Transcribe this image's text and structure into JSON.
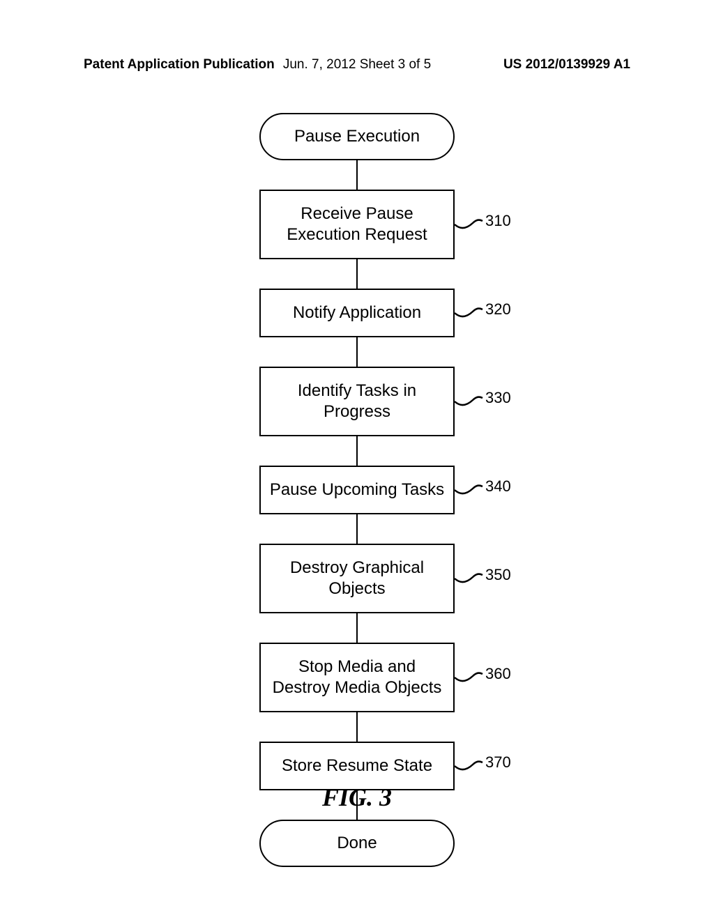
{
  "header": {
    "left": "Patent Application Publication",
    "center": "Jun. 7, 2012  Sheet 3 of 5",
    "right": "US 2012/0139929 A1"
  },
  "flowchart": {
    "start": "Pause Execution",
    "steps": [
      {
        "label": "Receive Pause Execution Request",
        "ref": "310"
      },
      {
        "label": "Notify Application",
        "ref": "320"
      },
      {
        "label": "Identify Tasks in Progress",
        "ref": "330"
      },
      {
        "label": "Pause Upcoming Tasks",
        "ref": "340"
      },
      {
        "label": "Destroy Graphical Objects",
        "ref": "350"
      },
      {
        "label": "Stop Media and Destroy Media Objects",
        "ref": "360"
      },
      {
        "label": "Store Resume State",
        "ref": "370"
      }
    ],
    "end": "Done"
  },
  "figure_label": "FIG. 3"
}
